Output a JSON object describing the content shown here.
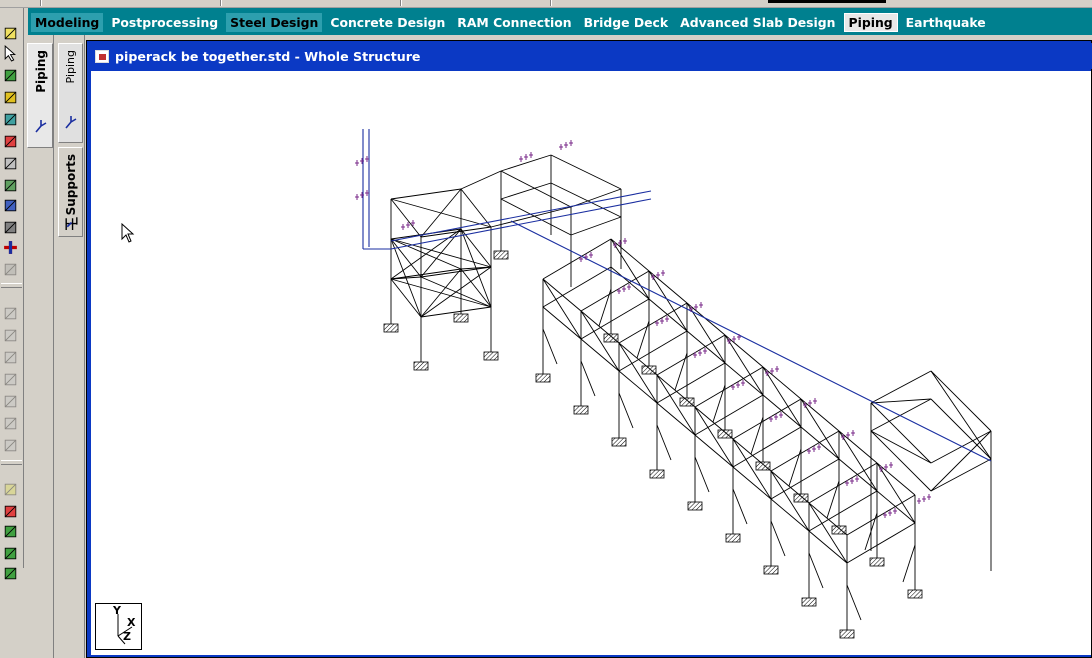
{
  "tabs": [
    {
      "label": "Modeling",
      "state": "dark"
    },
    {
      "label": "Postprocessing",
      "state": "normal"
    },
    {
      "label": "Steel Design",
      "state": "dark"
    },
    {
      "label": "Concrete Design",
      "state": "normal"
    },
    {
      "label": "RAM Connection",
      "state": "normal"
    },
    {
      "label": "Bridge Deck",
      "state": "normal"
    },
    {
      "label": "Advanced Slab Design",
      "state": "normal"
    },
    {
      "label": "Piping",
      "state": "selected"
    },
    {
      "label": "Earthquake",
      "state": "normal"
    }
  ],
  "page_control": {
    "piping_label": "Piping"
  },
  "sub_pages": {
    "piping_label": "Piping",
    "supports_label": "Supports"
  },
  "document": {
    "title": "piperack be together.std - Whole Structure"
  },
  "axis_triad": {
    "y_label": "Y",
    "x_label": "X",
    "z_label": "Z"
  },
  "toolbar_icons": [
    "rotate-select-icon",
    "pointer-icon",
    "node-select-icon",
    "beam-select-icon",
    "plate-select-icon",
    "eraser-icon",
    "text-tool-icon",
    "member-icon",
    "surface-icon",
    "solid-icon",
    "add-icon",
    "disabled-tool-icon",
    "disabled-tool-icon-2",
    "disabled-tool-icon-3",
    "disabled-tool-icon-4",
    "disabled-tool-icon-5",
    "disabled-tool-icon-6",
    "disabled-tool-icon-7",
    "disabled-tool-icon-8",
    "disabled-tool-icon-9",
    "geometry-tool-icon",
    "load-tool-icon",
    "support-tool-icon",
    "release-tool-icon"
  ],
  "colors": {
    "tab_bar": "#00808f",
    "title_bar": "#0b39c4",
    "structure_lines": "#000000",
    "pipe_lines": "#1a2ea0",
    "pipe_supports": "#7a2a8a"
  }
}
